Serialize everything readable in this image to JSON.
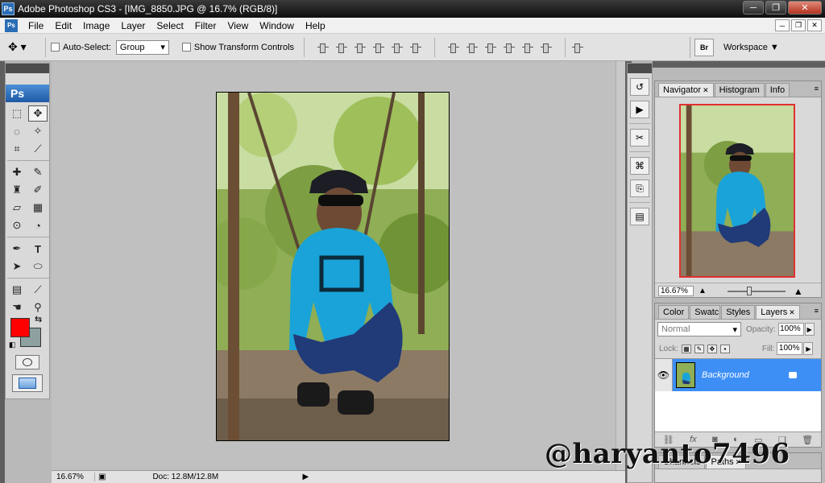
{
  "window": {
    "title": "Adobe Photoshop CS3 - [IMG_8850.JPG @ 16.7% (RGB/8)]",
    "app_icon_text": "Ps",
    "min_label": "─",
    "max_label": "❐",
    "close_label": "✕"
  },
  "menu": {
    "doc_icon_text": "Ps",
    "items": [
      "File",
      "Edit",
      "Image",
      "Layer",
      "Select",
      "Filter",
      "View",
      "Window",
      "Help"
    ],
    "mdi": [
      "─",
      "❐",
      "✕"
    ]
  },
  "options": {
    "auto_select_label": "Auto-Select:",
    "auto_select_value": "Group",
    "show_transform_label": "Show Transform Controls",
    "bridge_label": "Br",
    "workspace_label": "Workspace ▼"
  },
  "toolbox": {
    "logo": "Ps",
    "fg_color": "#ff0000",
    "bg_color": "#8ea0a0"
  },
  "status": {
    "zoom": "16.67%",
    "doc": "Doc: 12.8M/12.8M"
  },
  "navigator": {
    "tabs": [
      "Navigator",
      "Histogram",
      "Info"
    ],
    "zoom": "16.67%"
  },
  "layers_panel": {
    "tabs": [
      "Color",
      "Swatch",
      "Styles",
      "Layers"
    ],
    "blend_mode": "Normal",
    "opacity_label": "Opacity:",
    "opacity_value": "100%",
    "lock_label": "Lock:",
    "fill_label": "Fill:",
    "fill_value": "100%",
    "layers": [
      {
        "name": "Background",
        "visible": true,
        "locked": true
      }
    ],
    "footer_icons": [
      "link-icon",
      "fx-icon",
      "mask-icon",
      "adjustment-icon",
      "group-icon",
      "new-layer-icon",
      "trash-icon"
    ]
  },
  "bottom_panel": {
    "tabs": [
      "Channels",
      "Paths"
    ]
  },
  "watermark": "@haryanto7496"
}
